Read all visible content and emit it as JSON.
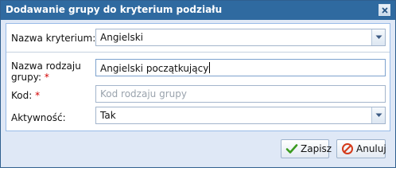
{
  "window": {
    "title": "Dodawanie grupy do kryterium podziału"
  },
  "form": {
    "criterion": {
      "label": "Nazwa kryterium:",
      "required_mark": "*",
      "value": "Angielski"
    },
    "group_type_name": {
      "label_line1": "Nazwa rodzaju",
      "label_line2": "grupy:",
      "required_mark": "*",
      "value": "Angielski początkujący"
    },
    "code": {
      "label": "Kod:",
      "required_mark": "*",
      "value": "",
      "placeholder": "Kod rodzaju grupy"
    },
    "active": {
      "label": "Aktywność:",
      "value": "Tak"
    }
  },
  "buttons": {
    "save": "Zapisz",
    "cancel": "Anuluj"
  },
  "colors": {
    "title_bar": "#2f6aa0",
    "dialog_bg": "#dfe8f6",
    "required": "#d40000",
    "save_icon": "#3a9a1e",
    "cancel_icon": "#d43a1a"
  }
}
